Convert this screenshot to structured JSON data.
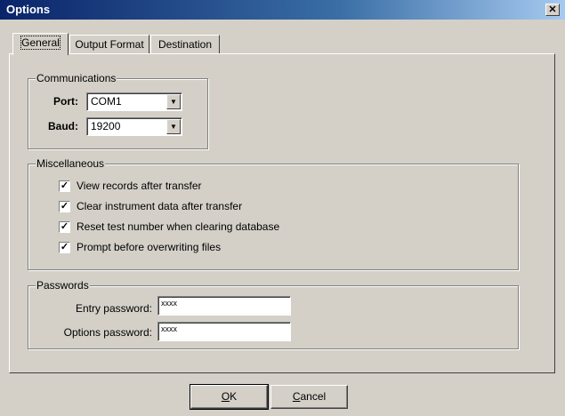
{
  "window": {
    "title": "Options",
    "close_glyph": "✕"
  },
  "tabs": [
    {
      "label": "General",
      "active": true
    },
    {
      "label": "Output Format",
      "active": false
    },
    {
      "label": "Destination",
      "active": false
    }
  ],
  "communications": {
    "title": "Communications",
    "port": {
      "label": "Port:",
      "value": "COM1"
    },
    "baud": {
      "label": "Baud:",
      "value": "19200"
    }
  },
  "misc": {
    "title": "Miscellaneous",
    "items": [
      {
        "label": "View records after transfer",
        "checked": true
      },
      {
        "label": "Clear instrument data after transfer",
        "checked": true
      },
      {
        "label": "Reset test number when clearing database",
        "checked": true
      },
      {
        "label": "Prompt before overwriting files",
        "checked": true
      }
    ]
  },
  "passwords": {
    "title": "Passwords",
    "entry": {
      "label": "Entry password:",
      "value": "xxxx"
    },
    "options": {
      "label": "Options password:",
      "value": "xxxx"
    }
  },
  "buttons": {
    "ok": {
      "mnemonic": "O",
      "rest": "K"
    },
    "cancel": {
      "mnemonic": "C",
      "rest": "ancel"
    }
  }
}
